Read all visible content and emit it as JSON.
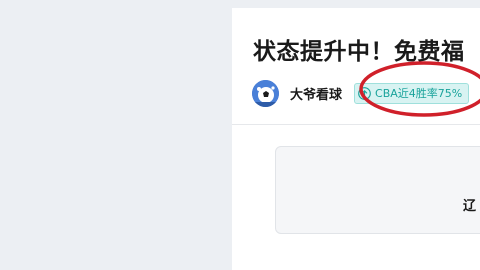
{
  "article": {
    "title": "状态提升中！免费福",
    "author": {
      "name": "大爷看球",
      "avatar_icon": "soccer-ball-avatar"
    },
    "tag": {
      "icon": "trend-up-icon",
      "label": "CBA近4胜率75%"
    }
  },
  "match": {
    "team": "辽"
  },
  "colors": {
    "page_background": "#eceff3",
    "tag_background": "#d8f3f2",
    "tag_text": "#1aa39b",
    "annotation_ring": "#d0202a"
  }
}
